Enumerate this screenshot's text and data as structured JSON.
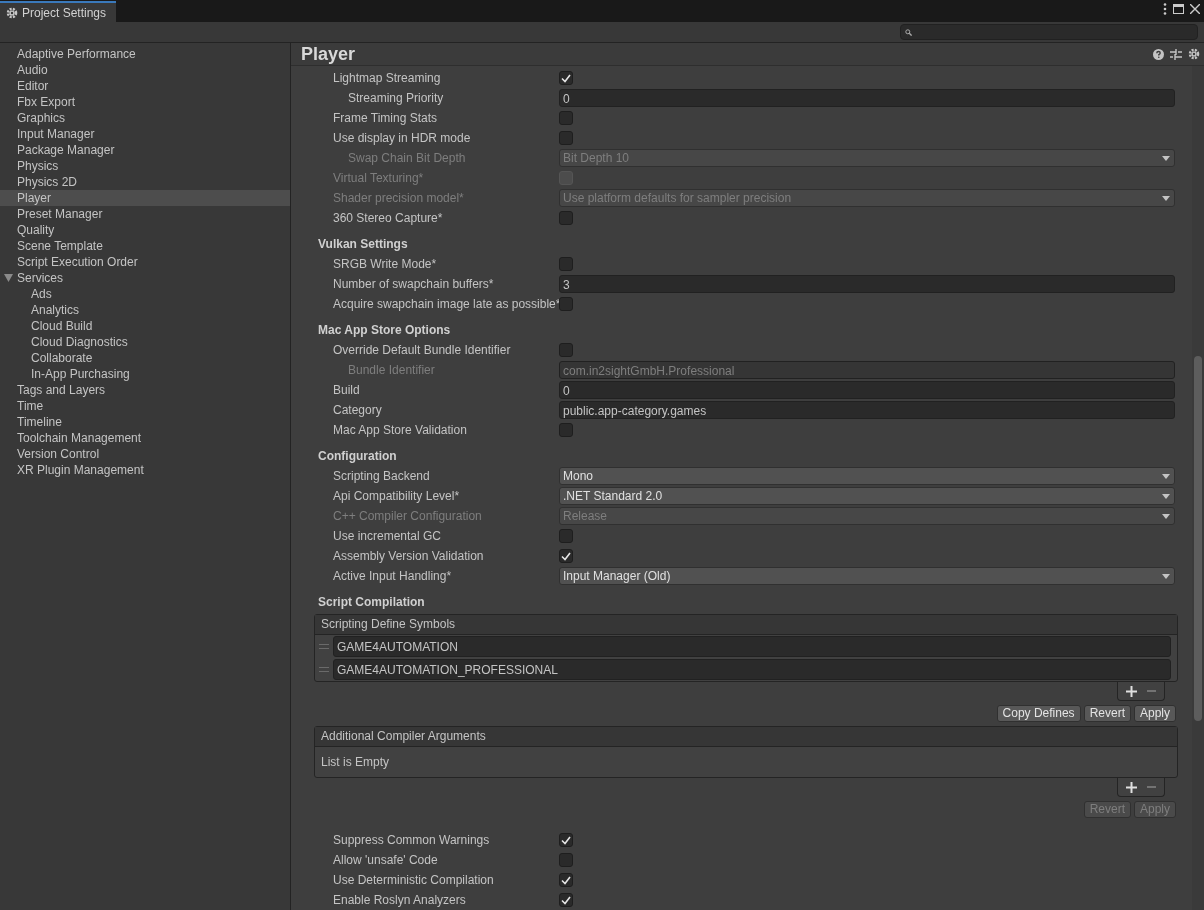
{
  "window": {
    "title": "Project Settings"
  },
  "sidebar": {
    "items": [
      {
        "label": "Adaptive Performance",
        "selected": false
      },
      {
        "label": "Audio",
        "selected": false
      },
      {
        "label": "Editor",
        "selected": false
      },
      {
        "label": "Fbx Export",
        "selected": false
      },
      {
        "label": "Graphics",
        "selected": false
      },
      {
        "label": "Input Manager",
        "selected": false
      },
      {
        "label": "Package Manager",
        "selected": false
      },
      {
        "label": "Physics",
        "selected": false
      },
      {
        "label": "Physics 2D",
        "selected": false
      },
      {
        "label": "Player",
        "selected": true
      },
      {
        "label": "Preset Manager",
        "selected": false
      },
      {
        "label": "Quality",
        "selected": false
      },
      {
        "label": "Scene Template",
        "selected": false
      },
      {
        "label": "Script Execution Order",
        "selected": false
      },
      {
        "label": "Services",
        "selected": false,
        "expanded": true,
        "children": [
          {
            "label": "Ads",
            "selected": false
          },
          {
            "label": "Analytics",
            "selected": false
          },
          {
            "label": "Cloud Build",
            "selected": false
          },
          {
            "label": "Cloud Diagnostics",
            "selected": false
          },
          {
            "label": "Collaborate",
            "selected": false
          },
          {
            "label": "In-App Purchasing",
            "selected": false
          }
        ]
      },
      {
        "label": "Tags and Layers",
        "selected": false
      },
      {
        "label": "Time",
        "selected": false
      },
      {
        "label": "Timeline",
        "selected": false
      },
      {
        "label": "Toolchain Management",
        "selected": false
      },
      {
        "label": "Version Control",
        "selected": false
      },
      {
        "label": "XR Plugin Management",
        "selected": false
      }
    ]
  },
  "panel": {
    "title": "Player",
    "sections": [
      {
        "rows": [
          {
            "kind": "checkbox",
            "label": "Lightmap Streaming",
            "checked": true,
            "disabled": false,
            "children": [
              {
                "kind": "field",
                "label": "Streaming Priority",
                "value": "0",
                "disabled": false
              }
            ]
          },
          {
            "kind": "checkbox",
            "label": "Frame Timing Stats",
            "checked": false,
            "disabled": false
          },
          {
            "kind": "checkbox",
            "label": "Use display in HDR mode",
            "checked": false,
            "disabled": false,
            "children": [
              {
                "kind": "dropdown",
                "label": "Swap Chain Bit Depth",
                "value": "Bit Depth 10",
                "disabled": true
              }
            ]
          },
          {
            "kind": "checkbox",
            "label": "Virtual Texturing*",
            "checked": false,
            "disabled": true
          },
          {
            "kind": "dropdown",
            "label": "Shader precision model*",
            "value": "Use platform defaults for sampler precision",
            "disabled": true
          },
          {
            "kind": "checkbox",
            "label": "360 Stereo Capture*",
            "checked": false,
            "disabled": false
          }
        ]
      },
      {
        "title": "Vulkan Settings",
        "rows": [
          {
            "kind": "checkbox",
            "label": "SRGB Write Mode*",
            "checked": false,
            "disabled": false
          },
          {
            "kind": "field",
            "label": "Number of swapchain buffers*",
            "value": "3",
            "disabled": false
          },
          {
            "kind": "checkbox",
            "label": "Acquire swapchain image late as possible*",
            "checked": false,
            "disabled": false
          }
        ]
      },
      {
        "title": "Mac App Store Options",
        "rows": [
          {
            "kind": "checkbox",
            "label": "Override Default Bundle Identifier",
            "checked": false,
            "disabled": false,
            "children": [
              {
                "kind": "field",
                "label": "Bundle Identifier",
                "value": "com.in2sightGmbH.Professional",
                "disabled": true
              }
            ]
          },
          {
            "kind": "field",
            "label": "Build",
            "value": "0",
            "disabled": false
          },
          {
            "kind": "field",
            "label": "Category",
            "value": "public.app-category.games",
            "disabled": false
          },
          {
            "kind": "checkbox",
            "label": "Mac App Store Validation",
            "checked": false,
            "disabled": false
          }
        ]
      },
      {
        "title": "Configuration",
        "rows": [
          {
            "kind": "dropdown",
            "label": "Scripting Backend",
            "value": "Mono",
            "disabled": false
          },
          {
            "kind": "dropdown",
            "label": "Api Compatibility Level*",
            "value": ".NET Standard 2.0",
            "disabled": false
          },
          {
            "kind": "dropdown",
            "label": "C++ Compiler Configuration",
            "value": "Release",
            "disabled": true
          },
          {
            "kind": "checkbox",
            "label": "Use incremental GC",
            "checked": false,
            "disabled": false
          },
          {
            "kind": "checkbox",
            "label": "Assembly Version Validation",
            "checked": true,
            "disabled": false
          },
          {
            "kind": "dropdown",
            "label": "Active Input Handling*",
            "value": "Input Manager (Old)",
            "disabled": false
          }
        ]
      },
      {
        "title": "Script Compilation",
        "lists": [
          {
            "header": "Scripting Define Symbols",
            "items": [
              "GAME4AUTOMATION",
              "GAME4AUTOMATION_PROFESSIONAL"
            ],
            "buttons": [
              {
                "label": "Copy Defines",
                "disabled": false
              },
              {
                "label": "Revert",
                "disabled": false
              },
              {
                "label": "Apply",
                "disabled": false
              }
            ]
          },
          {
            "header": "Additional Compiler Arguments",
            "empty_text": "List is Empty",
            "buttons": [
              {
                "label": "Revert",
                "disabled": true
              },
              {
                "label": "Apply",
                "disabled": true
              }
            ]
          }
        ],
        "rows": [
          {
            "kind": "checkbox",
            "label": "Suppress Common Warnings",
            "checked": true,
            "disabled": false
          },
          {
            "kind": "checkbox",
            "label": "Allow 'unsafe' Code",
            "checked": false,
            "disabled": false
          },
          {
            "kind": "checkbox",
            "label": "Use Deterministic Compilation",
            "checked": true,
            "disabled": false
          },
          {
            "kind": "checkbox",
            "label": "Enable Roslyn Analyzers",
            "checked": true,
            "disabled": false
          }
        ]
      }
    ]
  }
}
